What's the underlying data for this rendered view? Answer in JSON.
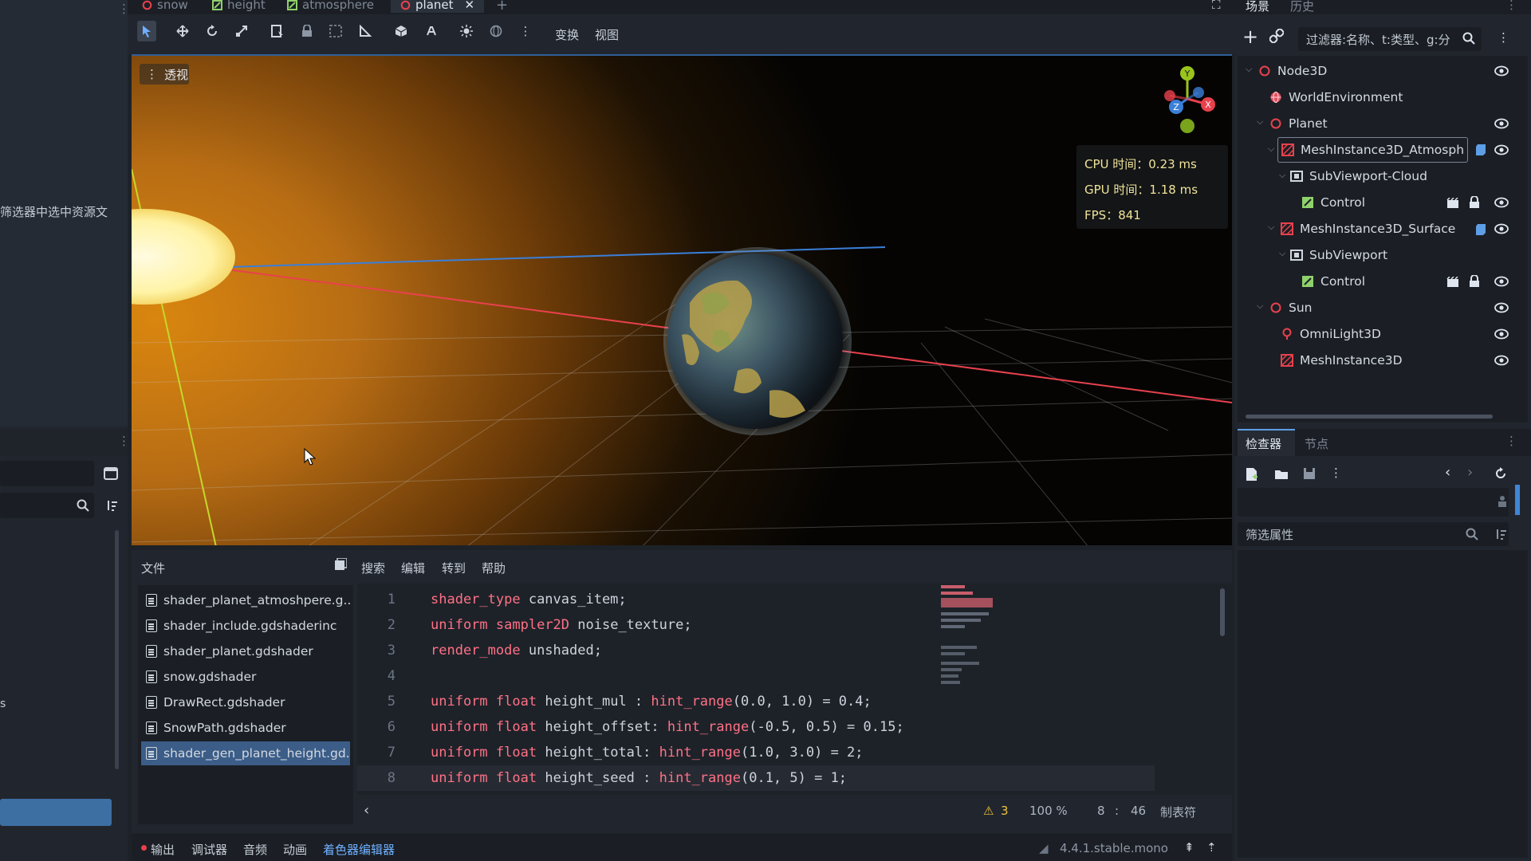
{
  "left_dock": {
    "hint_text": "筛选器中选中资源文",
    "stub_text": "s"
  },
  "tabs": [
    {
      "label": "snow",
      "icon": "ring-icon",
      "active": false
    },
    {
      "label": "height",
      "icon": "shader-icon",
      "active": false
    },
    {
      "label": "atmosphere",
      "icon": "shader-icon",
      "active": false
    },
    {
      "label": "planet",
      "icon": "ring-icon",
      "active": true
    }
  ],
  "toolbar": {
    "transform_label": "变换",
    "view_label": "视图"
  },
  "viewport": {
    "perspective_label": "透视",
    "stats": {
      "cpu": "CPU 时间：0.23 ms",
      "gpu": "GPU 时间：1.18 ms",
      "fps": "FPS：841"
    },
    "gizmo_axes": {
      "y": "Y",
      "z": "Z",
      "x": "X"
    },
    "colors": {
      "x_axis": "#e8414d",
      "y_axis": "#9ac41c",
      "z_axis": "#3a7fd9"
    }
  },
  "script_panel": {
    "menu": {
      "file": "文件",
      "search": "搜索",
      "edit": "编辑",
      "goto": "转到",
      "help": "帮助"
    },
    "files": [
      "shader_planet_atmoshpere.g...",
      "shader_include.gdshaderinc",
      "shader_planet.gdshader",
      "snow.gdshader",
      "DrawRect.gdshader",
      "SnowPath.gdshader",
      "shader_gen_planet_height.gd..."
    ],
    "selected_file_index": 6,
    "code_lines": [
      {
        "n": "1",
        "parts": [
          [
            "kw",
            "shader_type"
          ],
          [
            "",
            " canvas_item;"
          ]
        ]
      },
      {
        "n": "2",
        "parts": [
          [
            "kw",
            "uniform"
          ],
          [
            "",
            " "
          ],
          [
            "kw",
            "sampler2D"
          ],
          [
            "",
            " noise_texture;"
          ]
        ]
      },
      {
        "n": "3",
        "parts": [
          [
            "kw",
            "render_mode"
          ],
          [
            "",
            " unshaded;"
          ]
        ]
      },
      {
        "n": "4",
        "parts": []
      },
      {
        "n": "5",
        "parts": [
          [
            "kw",
            "uniform"
          ],
          [
            "",
            " "
          ],
          [
            "kw",
            "float"
          ],
          [
            "",
            " height_mul : "
          ],
          [
            "kw",
            "hint_range"
          ],
          [
            "",
            "(0.0, 1.0) = 0.4;"
          ]
        ]
      },
      {
        "n": "6",
        "parts": [
          [
            "kw",
            "uniform"
          ],
          [
            "",
            " "
          ],
          [
            "kw",
            "float"
          ],
          [
            "",
            " height_offset: "
          ],
          [
            "kw",
            "hint_range"
          ],
          [
            "",
            "(-0.5, 0.5) = 0.15;"
          ]
        ]
      },
      {
        "n": "7",
        "parts": [
          [
            "kw",
            "uniform"
          ],
          [
            "",
            " "
          ],
          [
            "kw",
            "float"
          ],
          [
            "",
            " height_total: "
          ],
          [
            "kw",
            "hint_range"
          ],
          [
            "",
            "(1.0, 3.0) = 2;"
          ]
        ]
      },
      {
        "n": "8",
        "parts": [
          [
            "kw",
            "uniform"
          ],
          [
            "",
            " "
          ],
          [
            "kw",
            "float"
          ],
          [
            "",
            " height_seed : "
          ],
          [
            "kw",
            "hint_range"
          ],
          [
            "",
            "(0.1, 5) = 1;"
          ]
        ]
      }
    ],
    "status": {
      "warnings": "3",
      "zoom": "100 %",
      "line": "8",
      "col": "46",
      "indent": "制表符"
    }
  },
  "bottom_tabs": {
    "output": "输出",
    "debugger": "调试器",
    "audio": "音频",
    "animation": "动画",
    "shader_editor": "着色器编辑器",
    "version": "4.4.1.stable.mono"
  },
  "scene_dock": {
    "tab_scene": "场景",
    "tab_history": "历史",
    "filter_placeholder": "过滤器:名称、t:类型、g:分",
    "nodes": [
      {
        "label": "Node3D",
        "depth": 0,
        "icon": "node3d-icon",
        "caret": true
      },
      {
        "label": "WorldEnvironment",
        "depth": 1,
        "icon": "world-icon",
        "caret": false
      },
      {
        "label": "Planet",
        "depth": 1,
        "icon": "node3d-icon",
        "caret": true
      },
      {
        "label": "MeshInstance3D_Atmosph",
        "depth": 2,
        "icon": "mesh-icon",
        "caret": true,
        "selected": true
      },
      {
        "label": "SubViewport-Cloud",
        "depth": 3,
        "icon": "subviewport-icon",
        "caret": true
      },
      {
        "label": "Control",
        "depth": 4,
        "icon": "control-icon",
        "caret": false
      },
      {
        "label": "MeshInstance3D_Surface",
        "depth": 2,
        "icon": "mesh-icon",
        "caret": true
      },
      {
        "label": "SubViewport",
        "depth": 3,
        "icon": "subviewport-icon",
        "caret": true
      },
      {
        "label": "Control",
        "depth": 4,
        "icon": "control-icon",
        "caret": false
      },
      {
        "label": "Sun",
        "depth": 1,
        "icon": "node3d-icon",
        "caret": true
      },
      {
        "label": "OmniLight3D",
        "depth": 2,
        "icon": "light-icon",
        "caret": false
      },
      {
        "label": "MeshInstance3D",
        "depth": 2,
        "icon": "mesh-icon",
        "caret": false
      }
    ]
  },
  "inspector": {
    "tab_inspector": "检查器",
    "tab_node": "节点",
    "filter_placeholder": "筛选属性"
  }
}
